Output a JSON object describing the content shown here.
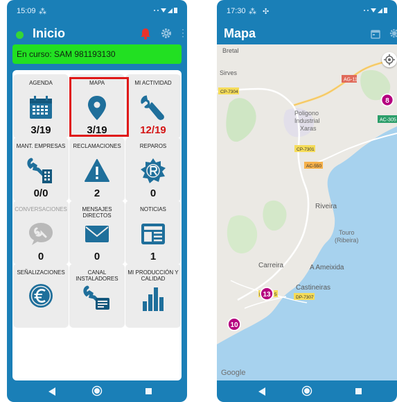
{
  "left_screen": {
    "status_bar": {
      "time": "15:09"
    },
    "title": "Inicio",
    "banner_text": "En curso: SAM 981193130",
    "tiles": [
      {
        "label": "AGENDA",
        "value": "3/19",
        "icon": "calendar-icon"
      },
      {
        "label": "MAPA",
        "value": "3/19",
        "icon": "map-pin-icon"
      },
      {
        "label": "MI ACTIVIDAD",
        "value": "12/19",
        "icon": "wrench-icon"
      },
      {
        "label": "MANT. EMPRESAS",
        "value": "0/0",
        "icon": "wrench-building-icon"
      },
      {
        "label": "RECLAMACIONES",
        "value": "2",
        "icon": "warning-icon"
      },
      {
        "label": "REPAROS",
        "value": "0",
        "icon": "badge-r-icon"
      },
      {
        "label": "CONVERSACIONES",
        "value": "0",
        "icon": "chat-wrench-icon"
      },
      {
        "label": "MENSAJES DIRECTOS",
        "value": "0",
        "icon": "envelope-icon"
      },
      {
        "label": "NOTICIAS",
        "value": "1",
        "icon": "newspaper-icon"
      },
      {
        "label": "SEÑALIZACIONES",
        "value": "",
        "icon": "euro-icon"
      },
      {
        "label": "CANAL INSTALADORES",
        "value": "",
        "icon": "wrench-chat-icon"
      },
      {
        "label": "MI PRODUCCIÓN Y CALIDAD",
        "value": "",
        "icon": "bar-chart-icon"
      }
    ],
    "colors": {
      "primary": "#1a7fb7",
      "banner": "#22e022",
      "accent_red": "#d41515",
      "tile_bg": "#ececec"
    }
  },
  "right_screen": {
    "status_bar": {
      "time": "17:30"
    },
    "title": "Mapa",
    "map_labels": {
      "bretal": "Bretal",
      "sirves": "Sirves",
      "cp7304": "CP-7304",
      "ag11": "AG-11",
      "ac305": "AC-305",
      "poligono": "Poligono",
      "industrial": "Industrial",
      "xaras": "Xaras",
      "cp7301": "CP-7301",
      "ac550": "AC-550",
      "riveira": "Riveira",
      "touro": "Touro",
      "ribeira": "(Ribeira)",
      "carreira": "Carreira",
      "ameixida": "A Ameixida",
      "castineiras": "Castineiras",
      "dp7307": "DP-7307",
      "dp_partial_d": "D",
      "dp_partial_5": "5",
      "google": "Google"
    },
    "markers": [
      "8",
      "13",
      "10"
    ],
    "colors": {
      "marker": "#b5007f",
      "water": "#a7d2ee",
      "land": "#ebe9e4"
    }
  }
}
